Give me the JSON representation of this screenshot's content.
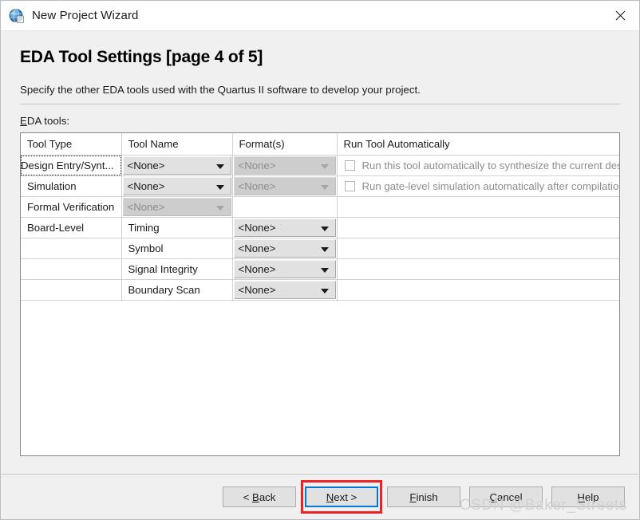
{
  "window": {
    "title": "New Project Wizard",
    "icon": "quartus-globe-icon",
    "close_label": "✕"
  },
  "page": {
    "title": "EDA Tool Settings [page 4 of 5]",
    "description": "Specify the other EDA tools used with the Quartus II software to develop your project.",
    "section_label_mnemonic": "E",
    "section_label_rest": "DA tools:"
  },
  "table": {
    "headers": [
      "Tool Type",
      "Tool Name",
      "Format(s)",
      "Run Tool Automatically"
    ],
    "rows": [
      {
        "tool_type": "Design Entry/Synt...",
        "tool_type_focused": true,
        "tool_name": {
          "kind": "combo",
          "value": "<None>",
          "disabled": false
        },
        "format": {
          "kind": "combo",
          "value": "<None>",
          "disabled": true
        },
        "run": {
          "kind": "checkbox",
          "checked": false,
          "label": "Run this tool automatically to synthesize the current design"
        }
      },
      {
        "tool_type": "Simulation",
        "tool_type_focused": false,
        "tool_name": {
          "kind": "combo",
          "value": "<None>",
          "disabled": false
        },
        "format": {
          "kind": "combo",
          "value": "<None>",
          "disabled": true
        },
        "run": {
          "kind": "checkbox",
          "checked": false,
          "label": "Run gate-level simulation automatically after compilation"
        }
      },
      {
        "tool_type": "Formal Verification",
        "tool_type_focused": false,
        "tool_name": {
          "kind": "combo",
          "value": "<None>",
          "disabled": true
        },
        "format": {
          "kind": "empty"
        },
        "run": {
          "kind": "empty"
        }
      },
      {
        "tool_type": "Board-Level",
        "tool_type_focused": false,
        "tool_name": {
          "kind": "text",
          "value": "Timing"
        },
        "format": {
          "kind": "combo",
          "value": "<None>",
          "disabled": false
        },
        "run": {
          "kind": "empty"
        }
      },
      {
        "tool_type": "",
        "tool_type_focused": false,
        "tool_name": {
          "kind": "text",
          "value": "Symbol"
        },
        "format": {
          "kind": "combo",
          "value": "<None>",
          "disabled": false
        },
        "run": {
          "kind": "empty"
        }
      },
      {
        "tool_type": "",
        "tool_type_focused": false,
        "tool_name": {
          "kind": "text",
          "value": "Signal Integrity"
        },
        "format": {
          "kind": "combo",
          "value": "<None>",
          "disabled": false
        },
        "run": {
          "kind": "empty"
        }
      },
      {
        "tool_type": "",
        "tool_type_focused": false,
        "tool_name": {
          "kind": "text",
          "value": "Boundary Scan"
        },
        "format": {
          "kind": "combo",
          "value": "<None>",
          "disabled": false
        },
        "run": {
          "kind": "empty"
        }
      }
    ]
  },
  "footer": {
    "buttons": [
      {
        "name": "back",
        "prefix": "< ",
        "mnemonic": "B",
        "rest": "ack",
        "suffix": "",
        "highlighted": false
      },
      {
        "name": "next",
        "prefix": "",
        "mnemonic": "N",
        "rest": "ext",
        "suffix": " >",
        "highlighted": true
      },
      {
        "name": "finish",
        "prefix": "",
        "mnemonic": "F",
        "rest": "inish",
        "suffix": "",
        "highlighted": false
      },
      {
        "name": "cancel",
        "prefix": "",
        "mnemonic": "C",
        "rest": "ancel",
        "suffix": "",
        "highlighted": false
      },
      {
        "name": "help",
        "prefix": "",
        "mnemonic": "H",
        "rest": "elp",
        "suffix": "",
        "highlighted": false
      }
    ]
  },
  "watermark": "CSDN @Baker_Streets",
  "colors": {
    "dialog_bg": "#f0f0f0",
    "accent_focus": "#0078d7",
    "annotation_red": "#ee2222",
    "disabled_text": "#8d8d8d",
    "grid_line": "#d2d2d2",
    "panel_border": "#828790"
  }
}
